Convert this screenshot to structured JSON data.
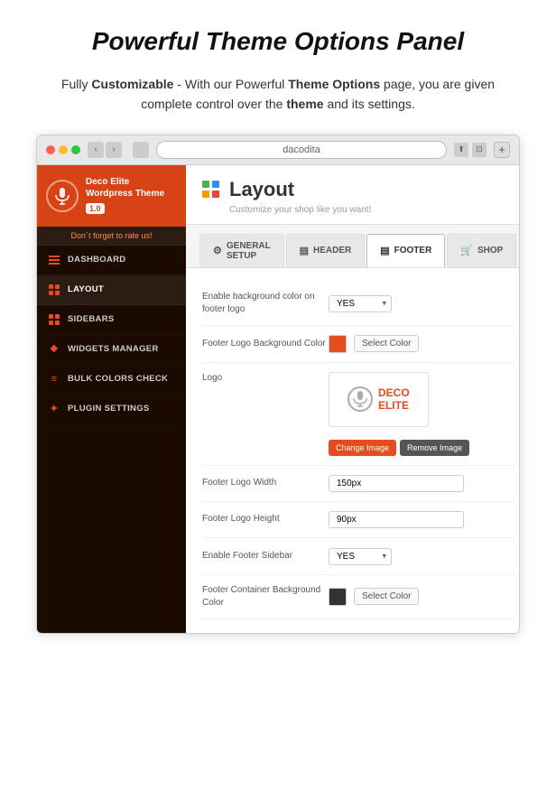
{
  "page": {
    "main_title": "Powerful Theme Options Panel",
    "description_part1": "Fully ",
    "description_bold1": "Customizable",
    "description_part2": " - With our Powerful ",
    "description_bold2": "Theme Options",
    "description_part3": " page, you are given complete control over the ",
    "description_bold3": "theme",
    "description_part4": " and its settings."
  },
  "browser": {
    "url": "dacodita",
    "plus_label": "+"
  },
  "sidebar": {
    "logo_name": "Deco Elite",
    "logo_subtitle": "Wordpress Theme",
    "version": "1.0",
    "rate_us": "Don´t forget to rate us!",
    "menu_items": [
      {
        "id": "dashboard",
        "label": "DASHBOARD"
      },
      {
        "id": "layout",
        "label": "LAYOUT"
      },
      {
        "id": "sidebars",
        "label": "SIDEBARS"
      },
      {
        "id": "widgets",
        "label": "WIDGETS MANAGER"
      },
      {
        "id": "bulkcolors",
        "label": "BULK COLORS CHECK"
      },
      {
        "id": "plugin",
        "label": "PLUGIN SETTINGS"
      }
    ]
  },
  "content": {
    "title": "Layout",
    "subtitle": "Customize your shop like you want!",
    "tabs": [
      {
        "id": "general",
        "label": "GENERAL SETUP",
        "icon": "⚙"
      },
      {
        "id": "header",
        "label": "HEADER",
        "icon": "▤"
      },
      {
        "id": "footer",
        "label": "FOOTER",
        "icon": "▤",
        "active": true
      },
      {
        "id": "shop",
        "label": "SHOP",
        "icon": "🛒"
      }
    ],
    "form_fields": [
      {
        "id": "bg_color_footer_logo",
        "label": "Enable background color on footer logo",
        "type": "select",
        "value": "YES"
      },
      {
        "id": "footer_logo_bg_color",
        "label": "Footer Logo Background Color",
        "type": "color",
        "color": "#e64c1f",
        "btn_label": "Select Color"
      },
      {
        "id": "logo",
        "label": "Logo",
        "type": "logo",
        "logo_text_line1": "DECO",
        "logo_text_line2": "ELITE",
        "btn_change": "Change Image",
        "btn_remove": "Remove Image"
      },
      {
        "id": "footer_logo_width",
        "label": "Footer Logo Width",
        "type": "text",
        "value": "150px"
      },
      {
        "id": "footer_logo_height",
        "label": "Footer Logo Height",
        "type": "text",
        "value": "90px"
      },
      {
        "id": "enable_footer_sidebar",
        "label": "Enable Footer Sidebar",
        "type": "select",
        "value": "YES"
      },
      {
        "id": "footer_container_bg_color",
        "label": "Footer Container Background Color",
        "type": "color",
        "color": "#333",
        "btn_label": "Select Color"
      }
    ]
  }
}
